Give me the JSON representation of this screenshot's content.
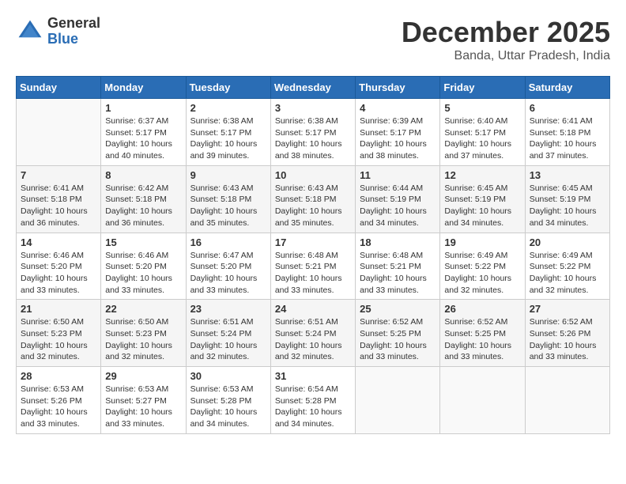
{
  "logo": {
    "general": "General",
    "blue": "Blue"
  },
  "title": "December 2025",
  "location": "Banda, Uttar Pradesh, India",
  "days_of_week": [
    "Sunday",
    "Monday",
    "Tuesday",
    "Wednesday",
    "Thursday",
    "Friday",
    "Saturday"
  ],
  "weeks": [
    [
      {
        "day": "",
        "info": ""
      },
      {
        "day": "1",
        "info": "Sunrise: 6:37 AM\nSunset: 5:17 PM\nDaylight: 10 hours\nand 40 minutes."
      },
      {
        "day": "2",
        "info": "Sunrise: 6:38 AM\nSunset: 5:17 PM\nDaylight: 10 hours\nand 39 minutes."
      },
      {
        "day": "3",
        "info": "Sunrise: 6:38 AM\nSunset: 5:17 PM\nDaylight: 10 hours\nand 38 minutes."
      },
      {
        "day": "4",
        "info": "Sunrise: 6:39 AM\nSunset: 5:17 PM\nDaylight: 10 hours\nand 38 minutes."
      },
      {
        "day": "5",
        "info": "Sunrise: 6:40 AM\nSunset: 5:17 PM\nDaylight: 10 hours\nand 37 minutes."
      },
      {
        "day": "6",
        "info": "Sunrise: 6:41 AM\nSunset: 5:18 PM\nDaylight: 10 hours\nand 37 minutes."
      }
    ],
    [
      {
        "day": "7",
        "info": "Sunrise: 6:41 AM\nSunset: 5:18 PM\nDaylight: 10 hours\nand 36 minutes."
      },
      {
        "day": "8",
        "info": "Sunrise: 6:42 AM\nSunset: 5:18 PM\nDaylight: 10 hours\nand 36 minutes."
      },
      {
        "day": "9",
        "info": "Sunrise: 6:43 AM\nSunset: 5:18 PM\nDaylight: 10 hours\nand 35 minutes."
      },
      {
        "day": "10",
        "info": "Sunrise: 6:43 AM\nSunset: 5:18 PM\nDaylight: 10 hours\nand 35 minutes."
      },
      {
        "day": "11",
        "info": "Sunrise: 6:44 AM\nSunset: 5:19 PM\nDaylight: 10 hours\nand 34 minutes."
      },
      {
        "day": "12",
        "info": "Sunrise: 6:45 AM\nSunset: 5:19 PM\nDaylight: 10 hours\nand 34 minutes."
      },
      {
        "day": "13",
        "info": "Sunrise: 6:45 AM\nSunset: 5:19 PM\nDaylight: 10 hours\nand 34 minutes."
      }
    ],
    [
      {
        "day": "14",
        "info": "Sunrise: 6:46 AM\nSunset: 5:20 PM\nDaylight: 10 hours\nand 33 minutes."
      },
      {
        "day": "15",
        "info": "Sunrise: 6:46 AM\nSunset: 5:20 PM\nDaylight: 10 hours\nand 33 minutes."
      },
      {
        "day": "16",
        "info": "Sunrise: 6:47 AM\nSunset: 5:20 PM\nDaylight: 10 hours\nand 33 minutes."
      },
      {
        "day": "17",
        "info": "Sunrise: 6:48 AM\nSunset: 5:21 PM\nDaylight: 10 hours\nand 33 minutes."
      },
      {
        "day": "18",
        "info": "Sunrise: 6:48 AM\nSunset: 5:21 PM\nDaylight: 10 hours\nand 33 minutes."
      },
      {
        "day": "19",
        "info": "Sunrise: 6:49 AM\nSunset: 5:22 PM\nDaylight: 10 hours\nand 32 minutes."
      },
      {
        "day": "20",
        "info": "Sunrise: 6:49 AM\nSunset: 5:22 PM\nDaylight: 10 hours\nand 32 minutes."
      }
    ],
    [
      {
        "day": "21",
        "info": "Sunrise: 6:50 AM\nSunset: 5:23 PM\nDaylight: 10 hours\nand 32 minutes."
      },
      {
        "day": "22",
        "info": "Sunrise: 6:50 AM\nSunset: 5:23 PM\nDaylight: 10 hours\nand 32 minutes."
      },
      {
        "day": "23",
        "info": "Sunrise: 6:51 AM\nSunset: 5:24 PM\nDaylight: 10 hours\nand 32 minutes."
      },
      {
        "day": "24",
        "info": "Sunrise: 6:51 AM\nSunset: 5:24 PM\nDaylight: 10 hours\nand 32 minutes."
      },
      {
        "day": "25",
        "info": "Sunrise: 6:52 AM\nSunset: 5:25 PM\nDaylight: 10 hours\nand 33 minutes."
      },
      {
        "day": "26",
        "info": "Sunrise: 6:52 AM\nSunset: 5:25 PM\nDaylight: 10 hours\nand 33 minutes."
      },
      {
        "day": "27",
        "info": "Sunrise: 6:52 AM\nSunset: 5:26 PM\nDaylight: 10 hours\nand 33 minutes."
      }
    ],
    [
      {
        "day": "28",
        "info": "Sunrise: 6:53 AM\nSunset: 5:26 PM\nDaylight: 10 hours\nand 33 minutes."
      },
      {
        "day": "29",
        "info": "Sunrise: 6:53 AM\nSunset: 5:27 PM\nDaylight: 10 hours\nand 33 minutes."
      },
      {
        "day": "30",
        "info": "Sunrise: 6:53 AM\nSunset: 5:28 PM\nDaylight: 10 hours\nand 34 minutes."
      },
      {
        "day": "31",
        "info": "Sunrise: 6:54 AM\nSunset: 5:28 PM\nDaylight: 10 hours\nand 34 minutes."
      },
      {
        "day": "",
        "info": ""
      },
      {
        "day": "",
        "info": ""
      },
      {
        "day": "",
        "info": ""
      }
    ]
  ]
}
